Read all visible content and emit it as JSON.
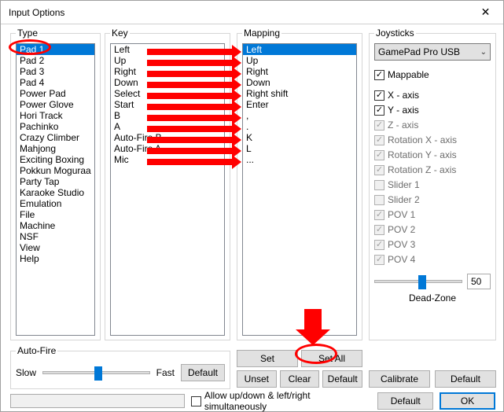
{
  "window": {
    "title": "Input Options",
    "close": "✕"
  },
  "type": {
    "legend": "Type",
    "selected": 0,
    "items": [
      "Pad 1",
      "Pad 2",
      "Pad 3",
      "Pad 4",
      "Power Pad",
      "Power Glove",
      "Hori Track",
      "Pachinko",
      "Crazy Climber",
      "Mahjong",
      "Exciting Boxing",
      "Pokkun Moguraa",
      "Party Tap",
      "Karaoke Studio",
      "Emulation",
      "File",
      "Machine",
      "NSF",
      "View",
      "Help"
    ]
  },
  "key": {
    "legend": "Key",
    "items": [
      "Left",
      "Up",
      "Right",
      "Down",
      "Select",
      "Start",
      "B",
      "A",
      "Auto-Fire B",
      "Auto-Fire A",
      "Mic"
    ]
  },
  "mapping": {
    "legend": "Mapping",
    "selected": 0,
    "items": [
      "Left",
      "Up",
      "Right",
      "Down",
      "Right shift",
      "Enter",
      ",",
      ".",
      "K",
      "L",
      "..."
    ]
  },
  "map_buttons": {
    "set": "Set",
    "set_all": "Set All",
    "unset": "Unset",
    "clear": "Clear",
    "default": "Default"
  },
  "joysticks": {
    "legend": "Joysticks",
    "device": "GamePad Pro USB",
    "checks": [
      {
        "label": "Mappable",
        "checked": true,
        "disabled": false
      },
      {
        "label": "X - axis",
        "checked": true,
        "disabled": false
      },
      {
        "label": "Y - axis",
        "checked": true,
        "disabled": false
      },
      {
        "label": "Z - axis",
        "checked": true,
        "disabled": true
      },
      {
        "label": "Rotation X - axis",
        "checked": true,
        "disabled": true
      },
      {
        "label": "Rotation Y - axis",
        "checked": true,
        "disabled": true
      },
      {
        "label": "Rotation Z - axis",
        "checked": true,
        "disabled": true
      },
      {
        "label": "Slider 1",
        "checked": false,
        "disabled": true
      },
      {
        "label": "Slider 2",
        "checked": false,
        "disabled": true
      },
      {
        "label": "POV 1",
        "checked": true,
        "disabled": true
      },
      {
        "label": "POV 2",
        "checked": true,
        "disabled": true
      },
      {
        "label": "POV 3",
        "checked": true,
        "disabled": true
      },
      {
        "label": "POV 4",
        "checked": true,
        "disabled": true
      }
    ],
    "deadzone_label": "Dead-Zone",
    "deadzone_value": "50",
    "calibrate": "Calibrate",
    "default": "Default"
  },
  "autofire": {
    "legend": "Auto-Fire",
    "slow": "Slow",
    "fast": "Fast",
    "default": "Default",
    "pos_pct": 48
  },
  "footer": {
    "simul": "Allow up/down & left/right simultaneously",
    "default": "Default",
    "ok": "OK"
  }
}
